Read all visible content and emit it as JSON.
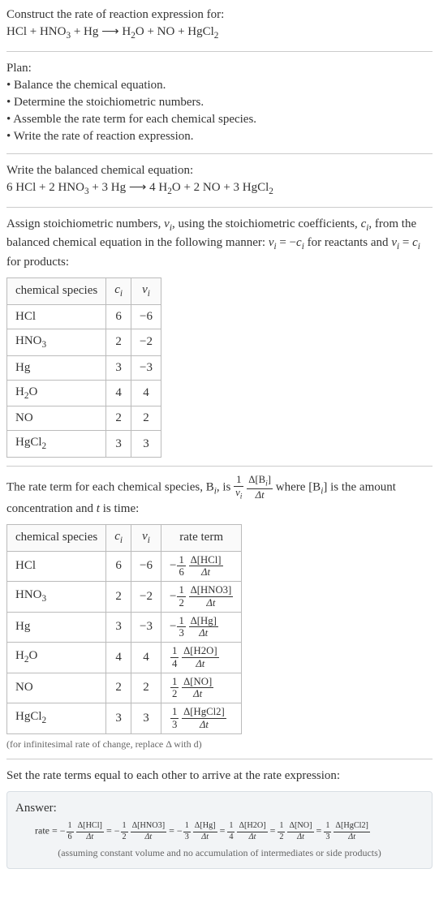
{
  "intro": {
    "line1": "Construct the rate of reaction expression for:",
    "unbalanced_lhs": "HCl + HNO",
    "unbalanced_sub1": "3",
    "unbalanced_mid1": " + Hg  ⟶  H",
    "unbalanced_sub2": "2",
    "unbalanced_mid2": "O + NO + HgCl",
    "unbalanced_sub3": "2"
  },
  "plan": {
    "title": "Plan:",
    "items": [
      "Balance the chemical equation.",
      "Determine the stoichiometric numbers.",
      "Assemble the rate term for each chemical species.",
      "Write the rate of reaction expression."
    ]
  },
  "balanced": {
    "title": "Write the balanced chemical equation:",
    "p1": "6 HCl + 2 HNO",
    "s1": "3",
    "p2": " + 3 Hg  ⟶  4 H",
    "s2": "2",
    "p3": "O + 2 NO + 3 HgCl",
    "s3": "2"
  },
  "stoich_intro": {
    "p1": "Assign stoichiometric numbers, ",
    "nu": "ν",
    "sub_i": "i",
    "p2": ", using the stoichiometric coefficients, ",
    "c": "c",
    "p3": ", from the balanced chemical equation in the following manner: ",
    "eq1a": "ν",
    "eq1b": " = −",
    "eq1c": "c",
    "p4": " for reactants and ",
    "eq2a": "ν",
    "eq2b": " = ",
    "eq2c": "c",
    "p5": " for products:"
  },
  "table1": {
    "headers": [
      "chemical species",
      "c",
      "ν"
    ],
    "header_sub": "i",
    "rows": [
      {
        "species": "HCl",
        "c": "6",
        "nu": "−6"
      },
      {
        "species_html": "HNO<sub>3</sub>",
        "species": "HNO",
        "sub": "3",
        "c": "2",
        "nu": "−2"
      },
      {
        "species": "Hg",
        "c": "3",
        "nu": "−3"
      },
      {
        "species_html": "H<sub>2</sub>O",
        "species": "H",
        "sub": "2",
        "suffix": "O",
        "c": "4",
        "nu": "4"
      },
      {
        "species": "NO",
        "c": "2",
        "nu": "2"
      },
      {
        "species_html": "HgCl<sub>2</sub>",
        "species": "HgCl",
        "sub": "2",
        "c": "3",
        "nu": "3"
      }
    ]
  },
  "rate_intro": {
    "p1": "The rate term for each chemical species, B",
    "sub_i": "i",
    "p2": ", is ",
    "frac1_num": "1",
    "frac1_den_a": "ν",
    "frac2_num_a": "Δ[B",
    "frac2_num_b": "]",
    "frac2_den": "Δt",
    "p3": " where [B",
    "p4": "] is the amount concentration and ",
    "t": "t",
    "p5": " is time:"
  },
  "table2": {
    "headers": [
      "chemical species",
      "c",
      "ν",
      "rate term"
    ],
    "header_sub": "i",
    "rows": [
      {
        "species": "HCl",
        "c": "6",
        "nu": "−6",
        "sign": "−",
        "coef_den": "6",
        "delta_sp": "Δ[HCl]"
      },
      {
        "species": "HNO",
        "sub": "3",
        "c": "2",
        "nu": "−2",
        "sign": "−",
        "coef_den": "2",
        "delta_sp": "Δ[HNO3]"
      },
      {
        "species": "Hg",
        "c": "3",
        "nu": "−3",
        "sign": "−",
        "coef_den": "3",
        "delta_sp": "Δ[Hg]"
      },
      {
        "species": "H",
        "sub": "2",
        "suffix": "O",
        "c": "4",
        "nu": "4",
        "sign": "",
        "coef_den": "4",
        "delta_sp": "Δ[H2O]"
      },
      {
        "species": "NO",
        "c": "2",
        "nu": "2",
        "sign": "",
        "coef_den": "2",
        "delta_sp": "Δ[NO]"
      },
      {
        "species": "HgCl",
        "sub": "2",
        "c": "3",
        "nu": "3",
        "sign": "",
        "coef_den": "3",
        "delta_sp": "Δ[HgCl2]"
      }
    ]
  },
  "note1": "(for infinitesimal rate of change, replace Δ with d)",
  "set_equal": "Set the rate terms equal to each other to arrive at the rate expression:",
  "answer": {
    "label": "Answer:",
    "prefix": "rate = ",
    "terms": [
      {
        "sign": "−",
        "den": "6",
        "sp": "Δ[HCl]"
      },
      {
        "sign": "−",
        "den": "2",
        "sp": "Δ[HNO3]"
      },
      {
        "sign": "−",
        "den": "3",
        "sp": "Δ[Hg]"
      },
      {
        "sign": "",
        "den": "4",
        "sp": "Δ[H2O]"
      },
      {
        "sign": "",
        "den": "2",
        "sp": "Δ[NO]"
      },
      {
        "sign": "",
        "den": "3",
        "sp": "Δ[HgCl2]"
      }
    ],
    "dt": "Δt",
    "assumption": "(assuming constant volume and no accumulation of intermediates or side products)"
  }
}
